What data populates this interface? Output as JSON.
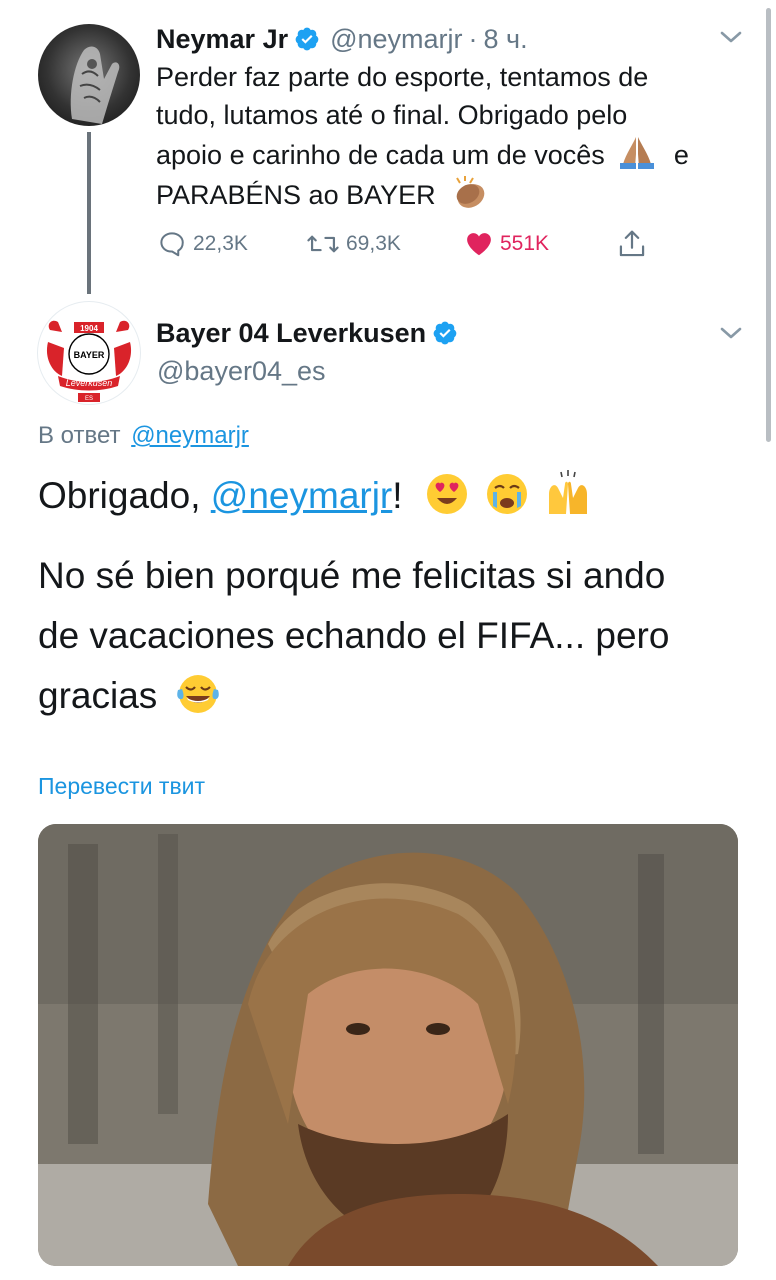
{
  "tweet1": {
    "author_name": "Neymar Jr",
    "handle": "@neymarjr",
    "separator": "·",
    "time": "8 ч.",
    "text_lines": [
      "Perder faz parte do esporte, tentamos de",
      "tudo, lutamos até o final. Obrigado pelo",
      "apoio e carinho de cada um de vocês",
      "PARABÉNS ao BAYER"
    ],
    "text_after_pray": "e",
    "replies": "22,3K",
    "retweets": "69,3K",
    "likes": "551K",
    "like_color": "#e0245e"
  },
  "tweet2": {
    "author_name": "Bayer 04 Leverkusen",
    "handle": "@bayer04_es",
    "reply_prefix": "В ответ",
    "reply_to": "@neymarjr",
    "line1_prefix": "Obrigado,",
    "line1_mention": "@neymarjr",
    "line1_suffix": "!",
    "body_lines": [
      "No sé bien porqué me felicitas si ando",
      "de vacaciones echando el FIFA... pero",
      "gracias"
    ],
    "translate": "Перевести твит",
    "logo_text": {
      "year": "1904",
      "brand": "BAYER",
      "city": "Leverkusen",
      "tag": "ES"
    }
  },
  "colors": {
    "accent": "#1b95e0",
    "verified": "#1da1f2",
    "muted": "#657786"
  },
  "icons": [
    "chevron-down-icon",
    "reply-icon",
    "retweet-icon",
    "heart-icon",
    "share-icon",
    "verified-icon"
  ]
}
